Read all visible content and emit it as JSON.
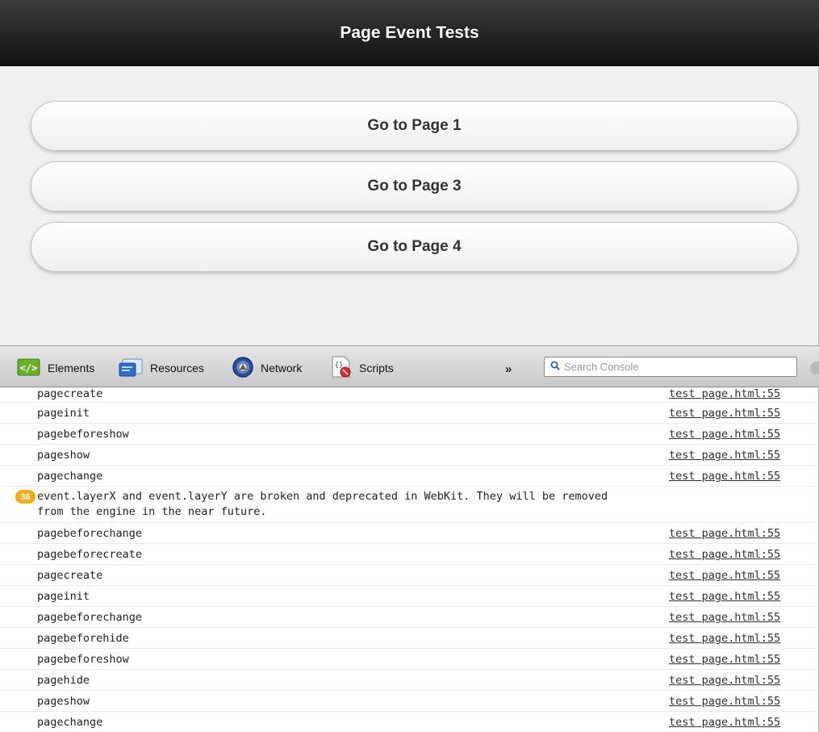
{
  "page": {
    "title": "Page Event Tests",
    "buttons": [
      "Go to Page 1",
      "Go to Page 3",
      "Go to Page 4"
    ]
  },
  "devtools": {
    "tabs": {
      "elements": "Elements",
      "resources": "Resources",
      "network": "Network",
      "scripts": "Scripts"
    },
    "more": "»",
    "search_placeholder": "Search Console"
  },
  "console": {
    "rows": [
      {
        "msg": "pagecreate",
        "src": "test page.html:55"
      },
      {
        "msg": "pageinit",
        "src": "test page.html:55"
      },
      {
        "msg": "pagebeforeshow",
        "src": "test page.html:55"
      },
      {
        "msg": "pageshow",
        "src": "test page.html:55"
      },
      {
        "msg": "pagechange",
        "src": "test page.html:55"
      }
    ],
    "warning": {
      "count": "36",
      "text": "event.layerX and event.layerY are broken and deprecated in WebKit. They will be removed\nfrom the engine in the near future."
    },
    "rows2": [
      {
        "msg": "pagebeforechange",
        "src": "test page.html:55"
      },
      {
        "msg": "pagebeforecreate",
        "src": "test page.html:55"
      },
      {
        "msg": "pagecreate",
        "src": "test page.html:55"
      },
      {
        "msg": "pageinit",
        "src": "test page.html:55"
      },
      {
        "msg": "pagebeforechange",
        "src": "test page.html:55"
      },
      {
        "msg": "pagebeforehide",
        "src": "test page.html:55"
      },
      {
        "msg": "pagebeforeshow",
        "src": "test page.html:55"
      },
      {
        "msg": "pagehide",
        "src": "test page.html:55"
      },
      {
        "msg": "pageshow",
        "src": "test page.html:55"
      },
      {
        "msg": "pagechange",
        "src": "test page.html:55"
      }
    ]
  },
  "colors": {
    "header_dark": "#111111",
    "page_bg": "#f0f0f0",
    "warning_badge": "#f3ac14"
  }
}
